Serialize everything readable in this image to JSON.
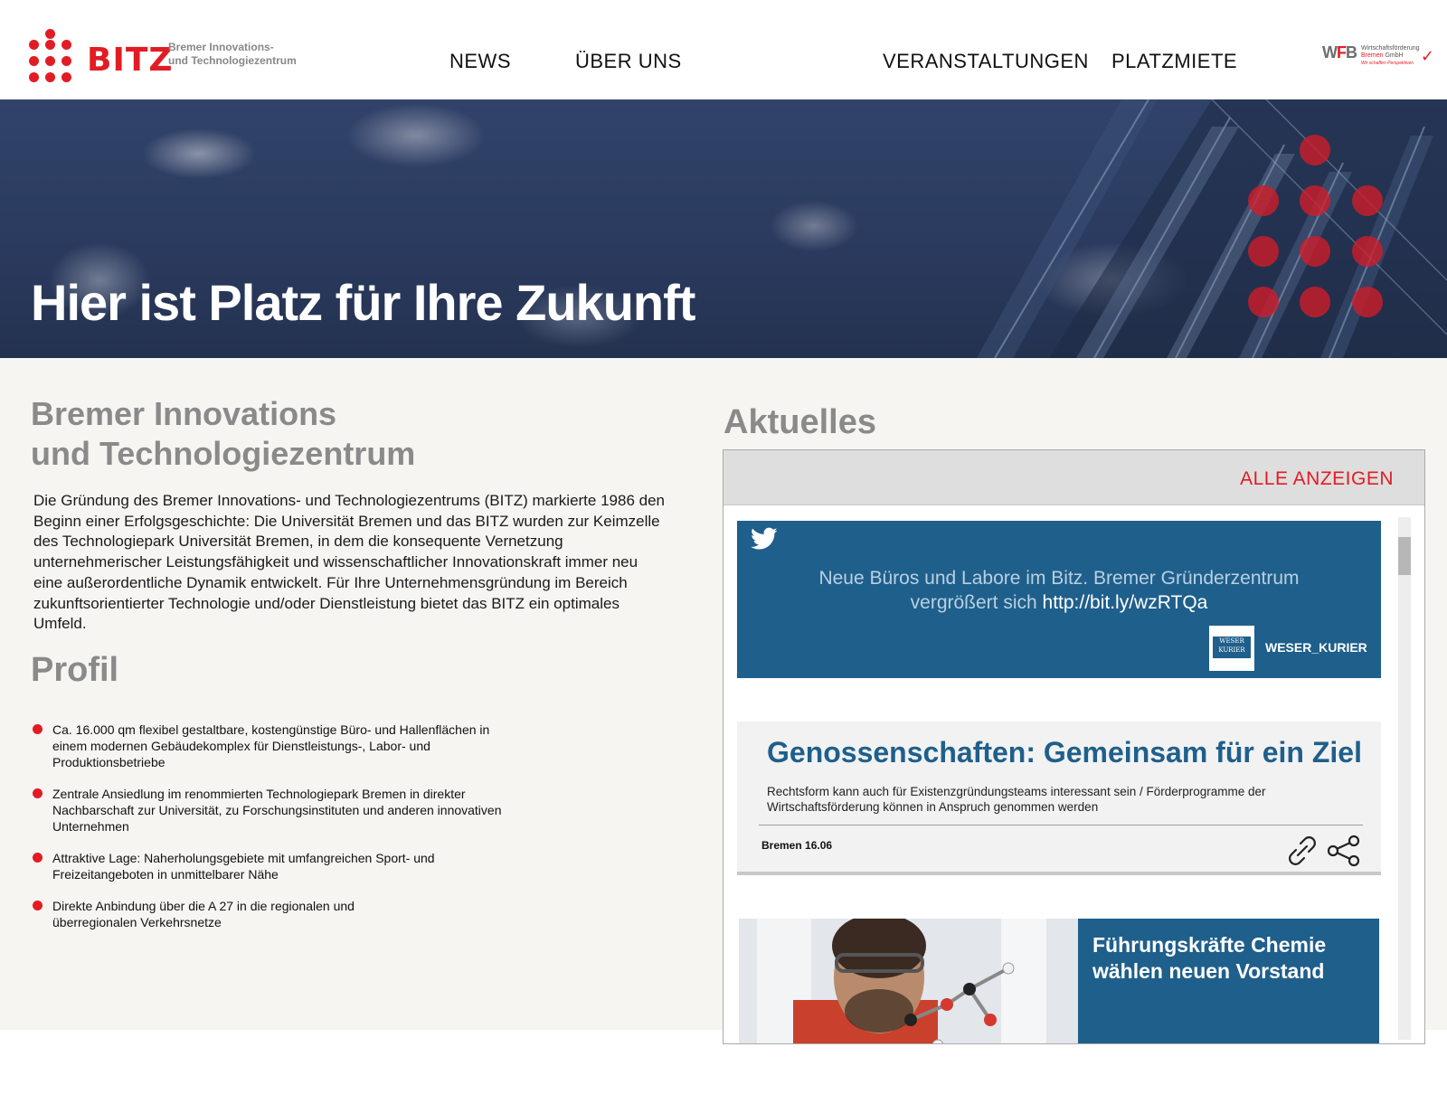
{
  "header": {
    "logo": {
      "word": "BITZ",
      "subtitle_line1": "Bremer Innovations-",
      "subtitle_line2": "und Technologiezentrum"
    },
    "nav": [
      {
        "label": "NEWS"
      },
      {
        "label": "ÜBER UNS"
      },
      {
        "label": "VERANSTALTUNGEN"
      },
      {
        "label": "PLATZMIETE"
      }
    ],
    "partner_logo": {
      "mark_w": "W",
      "mark_f": "F",
      "mark_b": "B",
      "line1": "Wirtschaftsförderung",
      "line2_red": "Bremen",
      "line2_rest": " GmbH",
      "line3": "Wir schaffen Perspektiven"
    }
  },
  "hero": {
    "title": "Hier ist Platz für Ihre Zukunft"
  },
  "intro": {
    "title_line1": "Bremer Innovations",
    "title_line2": "und Technologiezentrum",
    "text": "Die Gründung des Bremer Innovations- und Technologiezentrums (BITZ) markierte 1986 den Beginn einer Erfolgsgeschichte: Die Universität Bremen und das BITZ wurden zur Keimzelle des Technologiepark Universität Bremen, in dem die konsequente Vernetzung unternehmerischer Leistungsfähigkeit und wissenschaftlicher Innovationskraft immer neu eine außerordentliche Dynamik entwickelt. Für Ihre Unternehmensgründung im Bereich zukunftsorientierter Technologie und/oder Dienstleistung bietet das BITZ ein optimales Umfeld."
  },
  "profil": {
    "title": "Profil",
    "items": [
      {
        "text": "Ca. 16.000 qm flexibel gestaltbare, kostengünstige Büro- und Hallenflächen in einem modernen Gebäudekomplex für Dienstleistungs-, Labor- und Produktionsbetriebe"
      },
      {
        "text": "Zentrale Ansiedlung im renommierten Technologiepark Bremen in direkter Nachbarschaft zur Universität, zu Forschungsinstituten und anderen innovativen Unternehmen"
      },
      {
        "text": "Attraktive Lage: Naherholungsgebiete mit umfangreichen Sport- und Freizeitangeboten in unmittelbarer Nähe"
      },
      {
        "text": "Direkte Anbindung über die A 27 in die regionalen und überregionalen Verkehrsnetze"
      }
    ]
  },
  "aktuelles": {
    "title": "Aktuelles",
    "show_all_label": "ALLE ANZEIGEN",
    "tweet": {
      "icon": "twitter-bird-icon",
      "text_before_link": "Neue Büros und Labore im Bitz. Bremer Gründerzentrum vergrößert sich ",
      "link": "http://bit.ly/wzRTQa",
      "avatar_text_line1": "WESER",
      "avatar_text_line2": "KURIER",
      "user": "WESER_KURIER"
    },
    "article": {
      "title": "Genossenschaften: Gemeinsam für ein Ziel",
      "text": "Rechtsform kann auch für Existenzgründungsteams interessant sein / Förderprogramme der Wirtschaftsförderung können in Anspruch genommen werden",
      "meta": "Bremen 16.06",
      "icons": [
        "link-icon",
        "share-icon"
      ]
    },
    "card": {
      "title": "Führungskräfte Chemie wählen neuen Vorstand"
    }
  },
  "colors": {
    "brand_red": "#e21c24",
    "feed_blue": "#1f5f8b",
    "heading_grey": "#8a8a8a",
    "hero_navy": "#2a3a5e"
  }
}
